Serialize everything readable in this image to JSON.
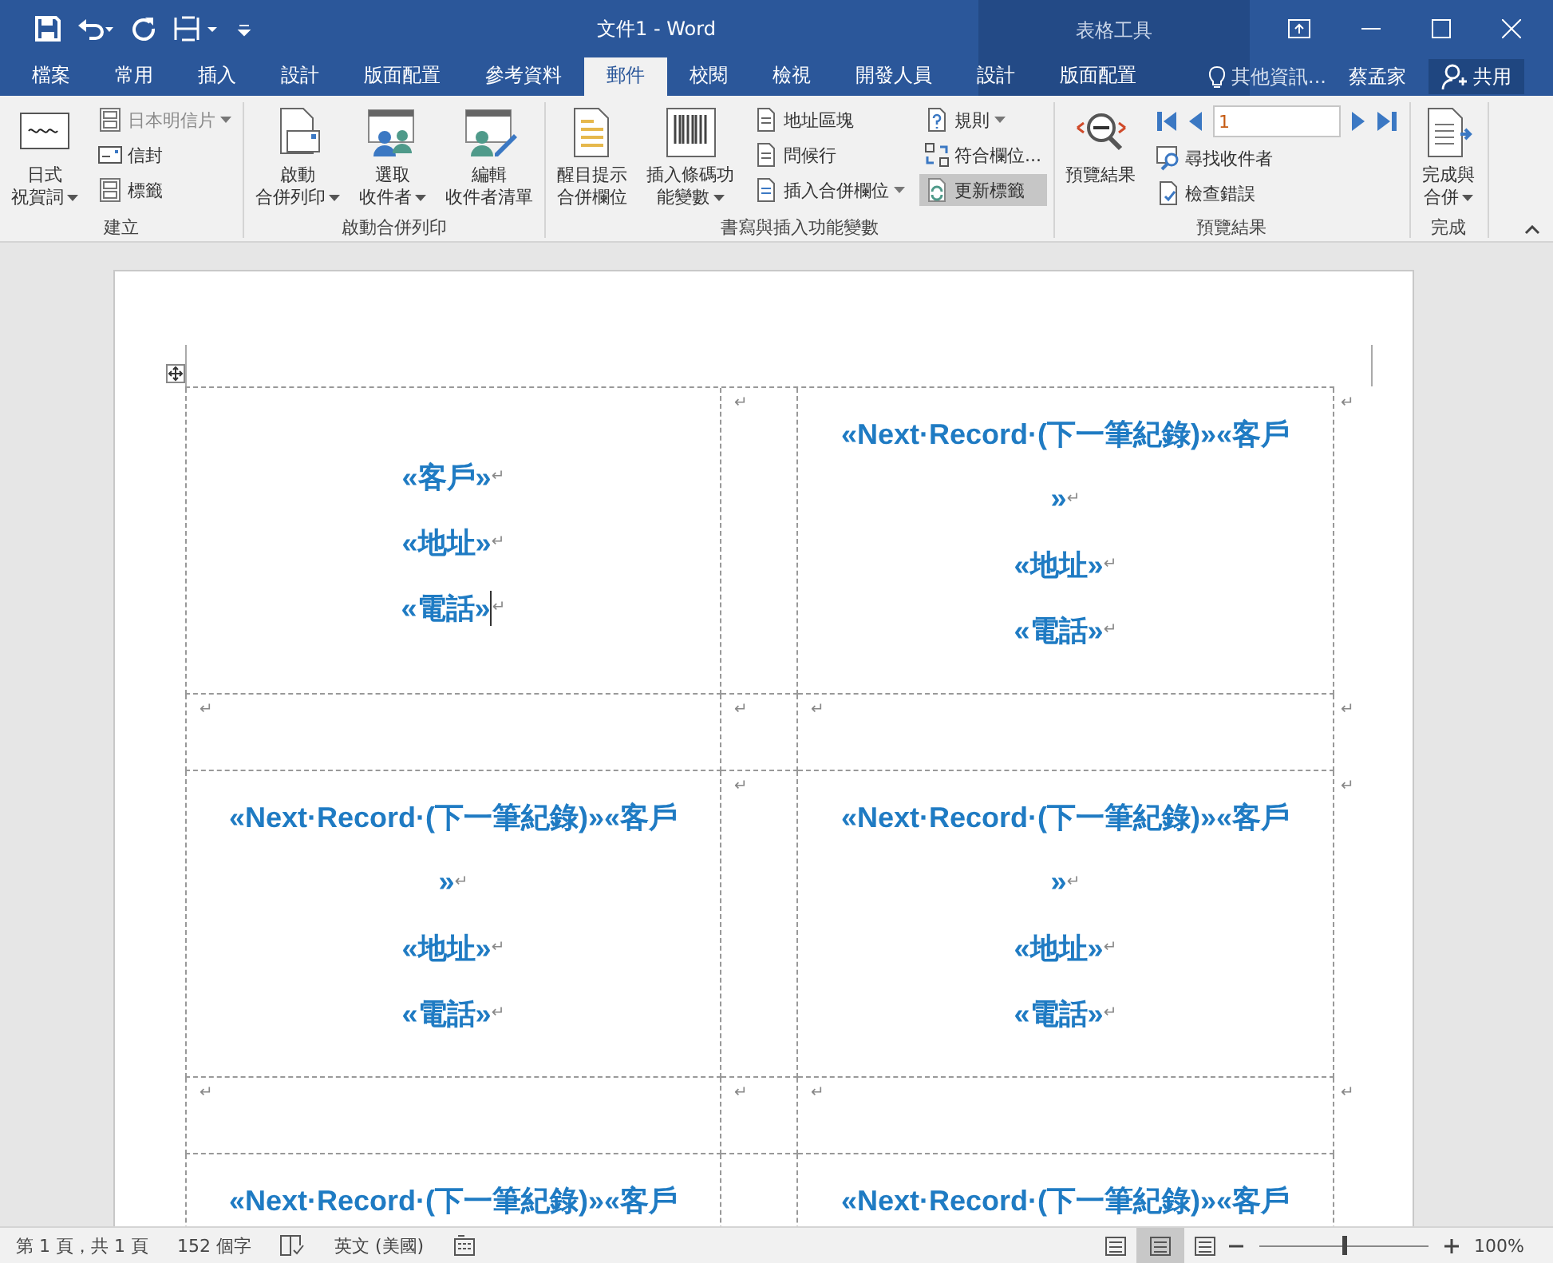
{
  "window": {
    "title": "文件1 - Word",
    "contextual_title": "表格工具"
  },
  "tabs": [
    {
      "label": "檔案",
      "selected": false
    },
    {
      "label": "常用",
      "selected": false
    },
    {
      "label": "插入",
      "selected": false
    },
    {
      "label": "設計",
      "selected": false
    },
    {
      "label": "版面配置",
      "selected": false
    },
    {
      "label": "參考資料",
      "selected": false
    },
    {
      "label": "郵件",
      "selected": true
    },
    {
      "label": "校閱",
      "selected": false
    },
    {
      "label": "檢視",
      "selected": false
    },
    {
      "label": "開發人員",
      "selected": false
    },
    {
      "label": "設計",
      "selected": false
    },
    {
      "label": "版面配置",
      "selected": false
    }
  ],
  "tell_me": "其他資訊...",
  "user": "蔡孟家",
  "share": "共用",
  "ribbon": {
    "groups": [
      {
        "label": "建立",
        "columns": [
          {
            "kind": "large",
            "lines": [
              "日式",
              "祝賀詞"
            ],
            "dropdown": true
          },
          {
            "kind": "stack",
            "items": [
              {
                "kind": "small",
                "label": "日本明信片",
                "dropdown": true,
                "disabled": true
              },
              {
                "kind": "small",
                "label": "信封",
                "dropdown": false,
                "disabled": false
              },
              {
                "kind": "small",
                "label": "標籤",
                "dropdown": false,
                "disabled": false
              }
            ]
          }
        ]
      },
      {
        "label": "啟動合併列印",
        "columns": [
          {
            "kind": "large",
            "lines": [
              "啟動",
              "合併列印"
            ],
            "dropdown": true
          },
          {
            "kind": "large",
            "lines": [
              "選取",
              "收件者"
            ],
            "dropdown": true
          },
          {
            "kind": "large",
            "lines": [
              "編輯",
              "收件者清單"
            ],
            "dropdown": false
          }
        ]
      },
      {
        "label": "書寫與插入功能變數",
        "columns": [
          {
            "kind": "large",
            "lines": [
              "醒目提示",
              "合併欄位"
            ],
            "dropdown": false
          },
          {
            "kind": "large",
            "lines": [
              "插入條碼功",
              "能變數"
            ],
            "dropdown": true
          },
          {
            "kind": "stack",
            "items": [
              {
                "kind": "small",
                "label": "地址區塊",
                "dropdown": false,
                "disabled": false
              },
              {
                "kind": "small",
                "label": "問候行",
                "dropdown": false,
                "disabled": false
              },
              {
                "kind": "small",
                "label": "插入合併欄位",
                "dropdown": true,
                "disabled": false
              }
            ]
          },
          {
            "kind": "stack",
            "items": [
              {
                "kind": "small",
                "label": "規則",
                "dropdown": true,
                "disabled": false,
                "selected": false
              },
              {
                "kind": "small",
                "label": "符合欄位...",
                "dropdown": false,
                "disabled": false,
                "selected": false
              },
              {
                "kind": "small",
                "label": "更新標籤",
                "dropdown": false,
                "disabled": false,
                "selected": true
              }
            ]
          }
        ]
      },
      {
        "label": "預覽結果",
        "columns": [
          {
            "kind": "large",
            "lines": [
              "預覽結果"
            ],
            "dropdown": false
          },
          {
            "kind": "stack",
            "items": [
              {
                "kind": "nav",
                "value": "1"
              },
              {
                "kind": "small",
                "label": "尋找收件者",
                "dropdown": false,
                "disabled": false
              },
              {
                "kind": "small",
                "label": "檢查錯誤",
                "dropdown": false,
                "disabled": false
              }
            ]
          }
        ]
      },
      {
        "label": "完成",
        "columns": [
          {
            "kind": "large",
            "lines": [
              "完成與",
              "合併"
            ],
            "dropdown": true
          }
        ]
      }
    ]
  },
  "document": {
    "rows": [
      {
        "kind": "label",
        "mark": "↵",
        "cells": [
          {
            "lines": [
              {
                "text": "«客戶»",
                "mark": "↵"
              },
              {
                "text": "«地址»",
                "mark": "↵"
              },
              {
                "text": "«電話»",
                "mark": "↵",
                "caret": true
              }
            ]
          },
          {
            "mark": "↵"
          },
          {
            "lines": [
              {
                "text": "«Next·Record·(下一筆紀錄)»«客戶"
              },
              {
                "text": "»",
                "mark": "↵"
              },
              {
                "text": "«地址»",
                "mark": "↵"
              },
              {
                "text": "«電話»",
                "mark": "↵"
              }
            ]
          }
        ]
      },
      {
        "kind": "gap",
        "mark": "↵",
        "cells": [
          {
            "mark": "↵"
          },
          {
            "mark": "↵"
          },
          {
            "mark": "↵"
          }
        ]
      },
      {
        "kind": "label",
        "mark": "↵",
        "cells": [
          {
            "lines": [
              {
                "text": "«Next·Record·(下一筆紀錄)»«客戶"
              },
              {
                "text": "»",
                "mark": "↵"
              },
              {
                "text": "«地址»",
                "mark": "↵"
              },
              {
                "text": "«電話»",
                "mark": "↵"
              }
            ]
          },
          {
            "mark": "↵"
          },
          {
            "lines": [
              {
                "text": "«Next·Record·(下一筆紀錄)»«客戶"
              },
              {
                "text": "»",
                "mark": "↵"
              },
              {
                "text": "«地址»",
                "mark": "↵"
              },
              {
                "text": "«電話»",
                "mark": "↵"
              }
            ]
          }
        ]
      },
      {
        "kind": "gap",
        "mark": "↵",
        "cells": [
          {
            "mark": "↵"
          },
          {
            "mark": "↵"
          },
          {
            "mark": "↵"
          }
        ]
      },
      {
        "kind": "label",
        "cells": [
          {
            "lines": [
              {
                "text": "«Next·Record·(下一筆紀錄)»«客戶"
              }
            ]
          },
          {},
          {
            "lines": [
              {
                "text": "«Next·Record·(下一筆紀錄)»«客戶"
              }
            ]
          }
        ]
      }
    ]
  },
  "status_bar": {
    "pages": "第 1 頁，共 1 頁",
    "words": "152 個字",
    "language": "英文 (美國)",
    "views": [
      {
        "selected": false
      },
      {
        "selected": true
      },
      {
        "selected": false
      }
    ],
    "zoom": {
      "level": 0.5,
      "reading": "100%"
    }
  }
}
